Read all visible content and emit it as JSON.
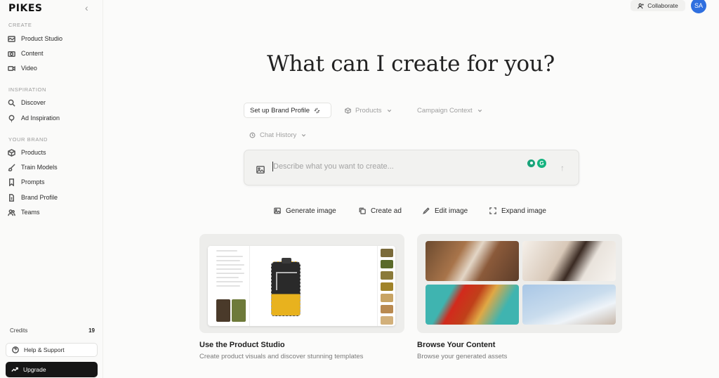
{
  "app": {
    "logo": "PIKES"
  },
  "sidebar": {
    "sections": {
      "create": "CREATE",
      "inspiration": "INSPIRATION",
      "your_brand": "YOUR BRAND"
    },
    "create_items": [
      {
        "label": "Product Studio",
        "icon": "product-studio-icon"
      },
      {
        "label": "Content",
        "icon": "camera-icon"
      },
      {
        "label": "Video",
        "icon": "video-icon"
      }
    ],
    "inspiration_items": [
      {
        "label": "Discover",
        "icon": "search-icon"
      },
      {
        "label": "Ad Inspiration",
        "icon": "lightbulb-icon"
      }
    ],
    "brand_items": [
      {
        "label": "Products",
        "icon": "box-icon"
      },
      {
        "label": "Train Models",
        "icon": "brush-icon"
      },
      {
        "label": "Prompts",
        "icon": "bookmark-icon"
      },
      {
        "label": "Brand Profile",
        "icon": "file-icon"
      },
      {
        "label": "Teams",
        "icon": "users-icon"
      }
    ],
    "credits_label": "Credits",
    "credits_value": "19",
    "help_label": "Help & Support",
    "upgrade_label": "Upgrade"
  },
  "header": {
    "collaborate_label": "Collaborate",
    "avatar_initials": "SA"
  },
  "main": {
    "heading": "What can I create for you?",
    "chips": {
      "brand_profile": "Set up Brand Profile",
      "products": "Products",
      "campaign_context": "Campaign Context",
      "chat_history": "Chat History"
    },
    "prompt_placeholder": "Describe what you want to create...",
    "actions": {
      "generate_image": "Generate image",
      "create_ad": "Create ad",
      "edit_image": "Edit image",
      "expand_image": "Expand image"
    },
    "cards": [
      {
        "title": "Use the Product Studio",
        "subtitle": "Create product visuals and discover stunning templates"
      },
      {
        "title": "Browse Your Content",
        "subtitle": "Browse your generated assets"
      }
    ]
  }
}
